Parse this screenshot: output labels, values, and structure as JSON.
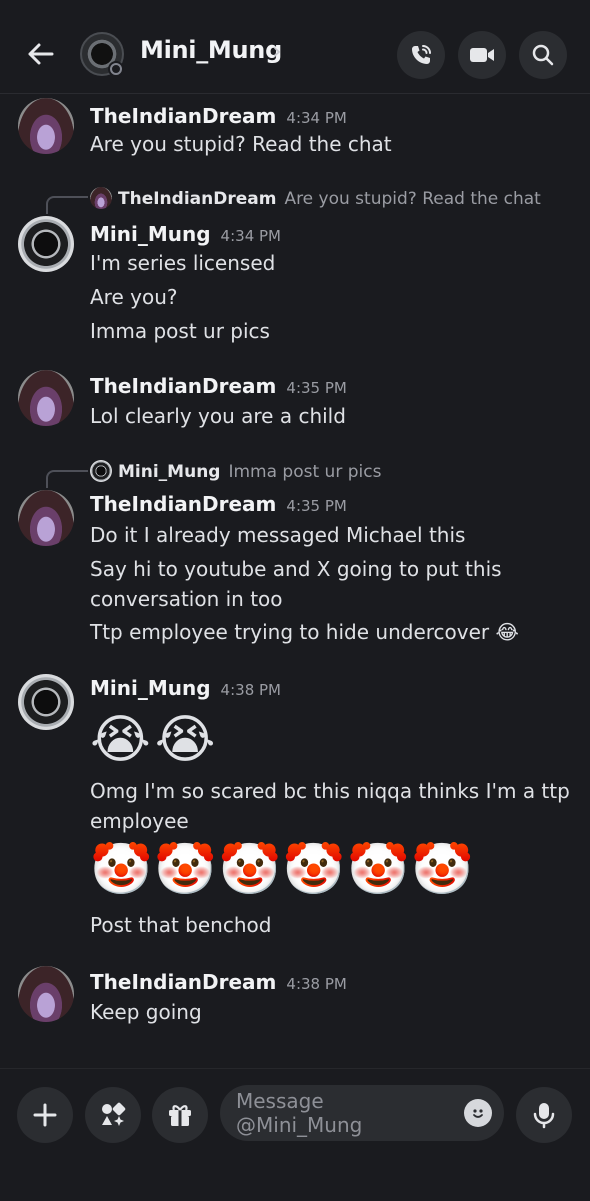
{
  "header": {
    "back_icon": "arrow-left-icon",
    "name": "Mini_Mung",
    "chevron": "›",
    "actions": [
      "phone-call-icon",
      "video-icon",
      "search-icon"
    ]
  },
  "messages": [
    {
      "author": "TheIndianDream",
      "time": "4:34 PM",
      "lines": [
        "Are you stupid? Read the chat"
      ]
    },
    {
      "reply_to": {
        "author": "TheIndianDream",
        "text": "Are you stupid? Read the chat"
      },
      "author": "Mini_Mung",
      "time": "4:34 PM",
      "lines": [
        "I'm series licensed",
        "Are you?",
        "Imma post ur pics"
      ]
    },
    {
      "author": "TheIndianDream",
      "time": "4:35 PM",
      "lines": [
        "Lol clearly you are a child"
      ]
    },
    {
      "reply_to": {
        "author": "Mini_Mung",
        "text": "Imma post ur pics"
      },
      "author": "TheIndianDream",
      "time": "4:35 PM",
      "lines": [
        "Do it I already messaged Michael this",
        "Say hi to youtube and X going to put this",
        "conversation in too",
        "Ttp employee trying to hide undercover 😂"
      ]
    },
    {
      "author": "Mini_Mung",
      "time": "4:38 PM",
      "lines": [
        "😭😭",
        "Omg I'm so scared bc this niqqa thinks I'm a ttp",
        "employee",
        "🤡🤡🤡🤡🤡🤡",
        "Post that benchod"
      ]
    },
    {
      "author": "TheIndianDream",
      "time": "4:38 PM",
      "lines": [
        "Keep going"
      ]
    }
  ],
  "composer": {
    "placeholder": "Message @Mini_Mung",
    "buttons": [
      "plus-icon",
      "apps-icon",
      "gift-icon",
      "emoji-icon",
      "microphone-icon"
    ]
  }
}
